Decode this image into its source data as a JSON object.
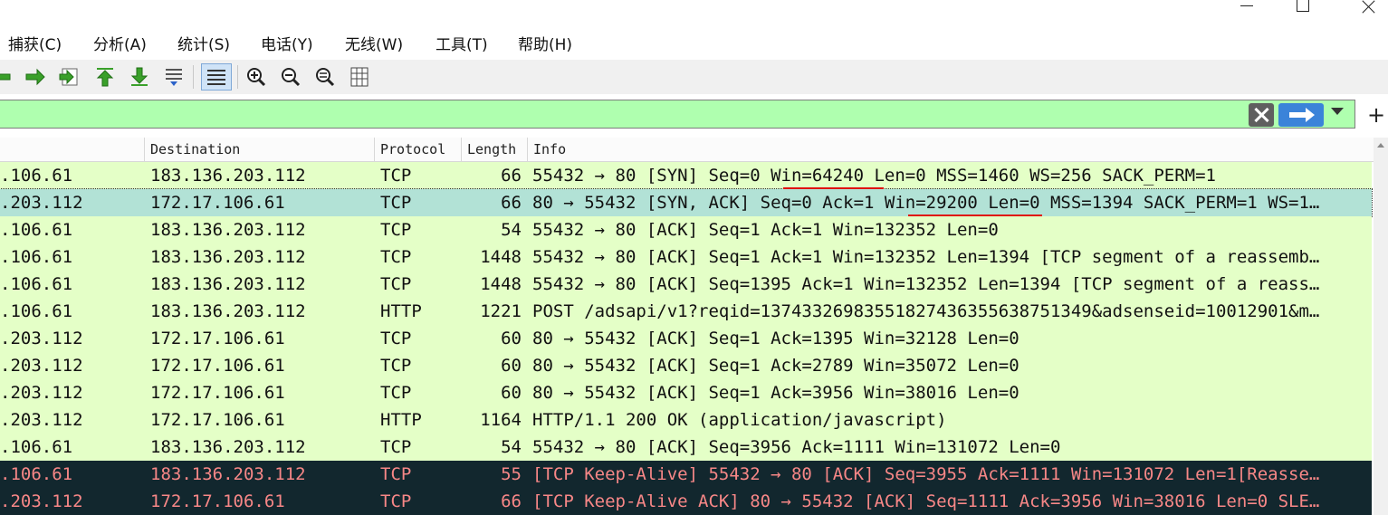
{
  "menu": [
    "捕获(C)",
    "分析(A)",
    "统计(S)",
    "电话(Y)",
    "无线(W)",
    "工具(T)",
    "帮助(H)"
  ],
  "toolbar": {
    "icons": [
      "go-back-icon",
      "go-forward-icon",
      "go-to-packet-icon",
      "first-packet-icon",
      "last-packet-icon",
      "auto-scroll-icon",
      "colorize-icon",
      "zoom-in-icon",
      "zoom-out-icon",
      "normal-size-icon",
      "resize-columns-icon"
    ]
  },
  "filter": {
    "value": ""
  },
  "columns": [
    "Destination",
    "Protocol",
    "Length",
    "Info"
  ],
  "colors": {
    "tcp_bg": "#e7e6ff",
    "green_bg": "#e4ffc7",
    "selected_bg": "#b2e2d6",
    "dark_bg": "#12272e",
    "dark_fg": "#f78787",
    "accent_red": "#e01010"
  },
  "rows": [
    {
      "src": ".106.61",
      "dst": "183.136.203.112",
      "proto": "TCP",
      "len": "66",
      "info": "55432 → 80 [SYN] Seq=0 Win=64240 Len=0 MSS=1460 WS=256 SACK_PERM=1",
      "style": "green"
    },
    {
      "src": ".203.112",
      "dst": "172.17.106.61",
      "proto": "TCP",
      "len": "66",
      "info": "80 → 55432 [SYN, ACK] Seq=0 Ack=1 Win=29200 Len=0 MSS=1394 SACK_PERM=1 WS=1…",
      "style": "selected"
    },
    {
      "src": ".106.61",
      "dst": "183.136.203.112",
      "proto": "TCP",
      "len": "54",
      "info": "55432 → 80 [ACK] Seq=1 Ack=1 Win=132352 Len=0",
      "style": "green"
    },
    {
      "src": ".106.61",
      "dst": "183.136.203.112",
      "proto": "TCP",
      "len": "1448",
      "info": "55432 → 80 [ACK] Seq=1 Ack=1 Win=132352 Len=1394 [TCP segment of a reassemb…",
      "style": "green"
    },
    {
      "src": ".106.61",
      "dst": "183.136.203.112",
      "proto": "TCP",
      "len": "1448",
      "info": "55432 → 80 [ACK] Seq=1395 Ack=1 Win=132352 Len=1394 [TCP segment of a reass…",
      "style": "green"
    },
    {
      "src": ".106.61",
      "dst": "183.136.203.112",
      "proto": "HTTP",
      "len": "1221",
      "info": "POST /adsapi/v1?reqid=1374332698355182743635563875134​9&adsenseid=10012901&m…",
      "style": "green"
    },
    {
      "src": ".203.112",
      "dst": "172.17.106.61",
      "proto": "TCP",
      "len": "60",
      "info": "80 → 55432 [ACK] Seq=1 Ack=1395 Win=32128 Len=0",
      "style": "green"
    },
    {
      "src": ".203.112",
      "dst": "172.17.106.61",
      "proto": "TCP",
      "len": "60",
      "info": "80 → 55432 [ACK] Seq=1 Ack=2789 Win=35072 Len=0",
      "style": "green"
    },
    {
      "src": ".203.112",
      "dst": "172.17.106.61",
      "proto": "TCP",
      "len": "60",
      "info": "80 → 55432 [ACK] Seq=1 Ack=3956 Win=38016 Len=0",
      "style": "green"
    },
    {
      "src": ".203.112",
      "dst": "172.17.106.61",
      "proto": "HTTP",
      "len": "1164",
      "info": "HTTP/1.1 200 OK  (application/javascript)",
      "style": "green"
    },
    {
      "src": ".106.61",
      "dst": "183.136.203.112",
      "proto": "TCP",
      "len": "54",
      "info": "55432 → 80 [ACK] Seq=3956 Ack=1111 Win=131072 Len=0",
      "style": "green"
    },
    {
      "src": ".106.61",
      "dst": "183.136.203.112",
      "proto": "TCP",
      "len": "55",
      "info": "[TCP Keep-Alive] 55432 → 80 [ACK] Seq=3955 Ack=1111 Win=131072 Len=1[Reasse…",
      "style": "dark"
    },
    {
      "src": ".203.112",
      "dst": "172.17.106.61",
      "proto": "TCP",
      "len": "66",
      "info": "[TCP Keep-Alive ACK] 80 → 55432 [ACK] Seq=1111 Ack=3956 Win=38016 Len=0 SLE…",
      "style": "dark"
    }
  ]
}
